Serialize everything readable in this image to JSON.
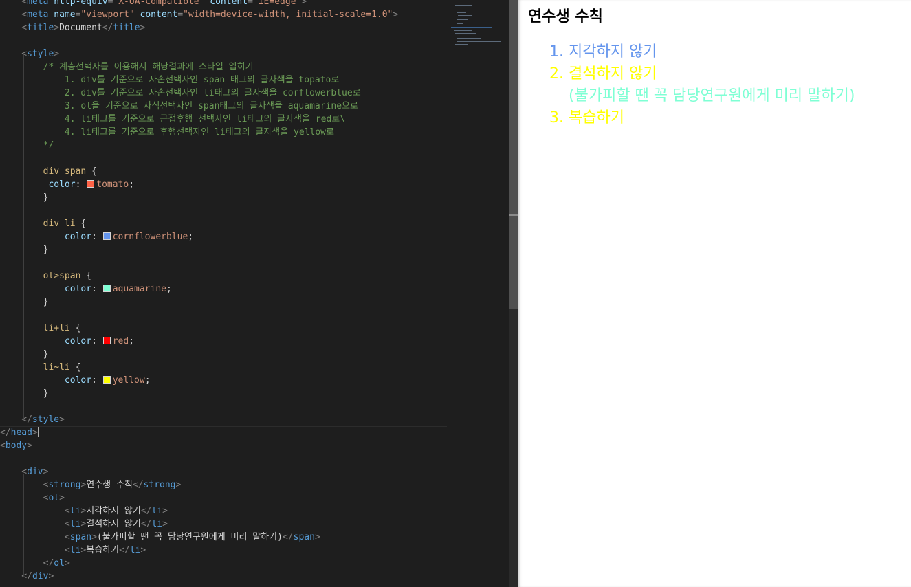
{
  "editor": {
    "lines": [
      [
        {
          "c": "t",
          "t": "    <"
        },
        {
          "c": "tn",
          "t": "meta "
        },
        {
          "c": "an",
          "t": "http-equiv"
        },
        {
          "c": "t",
          "t": "="
        },
        {
          "c": "av",
          "t": "\"X-UA-Compatible\" "
        },
        {
          "c": "an",
          "t": "content"
        },
        {
          "c": "t",
          "t": "="
        },
        {
          "c": "av",
          "t": "\"IE=edge\""
        },
        {
          "c": "t",
          "t": ">"
        }
      ],
      [
        {
          "c": "t",
          "t": "    <"
        },
        {
          "c": "tn",
          "t": "meta "
        },
        {
          "c": "an",
          "t": "name"
        },
        {
          "c": "t",
          "t": "="
        },
        {
          "c": "av",
          "t": "\"viewport\" "
        },
        {
          "c": "an",
          "t": "content"
        },
        {
          "c": "t",
          "t": "="
        },
        {
          "c": "av",
          "t": "\"width=device-width, initial-scale=1.0\""
        },
        {
          "c": "t",
          "t": ">"
        }
      ],
      [
        {
          "c": "t",
          "t": "    <"
        },
        {
          "c": "tn",
          "t": "title"
        },
        {
          "c": "t",
          "t": ">"
        },
        {
          "c": "",
          "t": "Document"
        },
        {
          "c": "t",
          "t": "</"
        },
        {
          "c": "tn",
          "t": "title"
        },
        {
          "c": "t",
          "t": ">"
        }
      ],
      [],
      [
        {
          "c": "t",
          "t": "    <"
        },
        {
          "c": "tn",
          "t": "style"
        },
        {
          "c": "t",
          "t": ">"
        }
      ],
      [
        {
          "c": "cm",
          "t": "        /* 계층선택자를 이용해서 해당결과에 스타일 입히기"
        }
      ],
      [
        {
          "c": "cm",
          "t": "            1. div를 기준으로 자손선택자인 span 태그의 글자색을 topato로"
        }
      ],
      [
        {
          "c": "cm",
          "t": "            2. div를 기준으로 자손선택자인 li태그의 글자색을 corflowerblue로"
        }
      ],
      [
        {
          "c": "cm",
          "t": "            3. ol을 기준으로 자식선택자인 span태그의 글자색을 aquamarine으로"
        }
      ],
      [
        {
          "c": "cm",
          "t": "            4. li태그를 기준으로 근접후행 선택자인 li태그의 글자색을 red로\\"
        }
      ],
      [
        {
          "c": "cm",
          "t": "            4. li태그를 기준으로 후행선택자인 li태그의 글자색을 yellow로"
        }
      ],
      [
        {
          "c": "cm",
          "t": "        */"
        }
      ],
      [],
      [
        {
          "c": "sel",
          "t": "        div span "
        },
        {
          "c": "",
          "t": "{"
        }
      ],
      [
        {
          "c": "",
          "t": "         "
        },
        {
          "c": "pr",
          "t": "color"
        },
        {
          "c": "",
          "t": ": "
        },
        {
          "c": "sw",
          "t": "",
          "col": "tomato"
        },
        {
          "c": "vl",
          "t": "tomato"
        },
        {
          "c": "",
          "t": ";"
        }
      ],
      [
        {
          "c": "",
          "t": "        }"
        }
      ],
      [],
      [
        {
          "c": "sel",
          "t": "        div li "
        },
        {
          "c": "",
          "t": "{"
        }
      ],
      [
        {
          "c": "",
          "t": "            "
        },
        {
          "c": "pr",
          "t": "color"
        },
        {
          "c": "",
          "t": ": "
        },
        {
          "c": "sw",
          "t": "",
          "col": "cornflowerblue"
        },
        {
          "c": "vl",
          "t": "cornflowerblue"
        },
        {
          "c": "",
          "t": ";"
        }
      ],
      [
        {
          "c": "",
          "t": "        }"
        }
      ],
      [],
      [
        {
          "c": "sel",
          "t": "        ol>span "
        },
        {
          "c": "",
          "t": "{"
        }
      ],
      [
        {
          "c": "",
          "t": "            "
        },
        {
          "c": "pr",
          "t": "color"
        },
        {
          "c": "",
          "t": ": "
        },
        {
          "c": "sw",
          "t": "",
          "col": "aquamarine"
        },
        {
          "c": "vl",
          "t": "aquamarine"
        },
        {
          "c": "",
          "t": ";"
        }
      ],
      [
        {
          "c": "",
          "t": "        }"
        }
      ],
      [],
      [
        {
          "c": "sel",
          "t": "        li+li "
        },
        {
          "c": "",
          "t": "{"
        }
      ],
      [
        {
          "c": "",
          "t": "            "
        },
        {
          "c": "pr",
          "t": "color"
        },
        {
          "c": "",
          "t": ": "
        },
        {
          "c": "sw",
          "t": "",
          "col": "red"
        },
        {
          "c": "vl",
          "t": "red"
        },
        {
          "c": "",
          "t": ";"
        }
      ],
      [
        {
          "c": "",
          "t": "        }"
        }
      ],
      [
        {
          "c": "sel",
          "t": "        li~li "
        },
        {
          "c": "",
          "t": "{"
        }
      ],
      [
        {
          "c": "",
          "t": "            "
        },
        {
          "c": "pr",
          "t": "color"
        },
        {
          "c": "",
          "t": ": "
        },
        {
          "c": "sw",
          "t": "",
          "col": "yellow"
        },
        {
          "c": "vl",
          "t": "yellow"
        },
        {
          "c": "",
          "t": ";"
        }
      ],
      [
        {
          "c": "",
          "t": "        }"
        }
      ],
      [],
      [
        {
          "c": "t",
          "t": "    </"
        },
        {
          "c": "tn",
          "t": "style"
        },
        {
          "c": "t",
          "t": ">"
        }
      ],
      [
        {
          "c": "t",
          "t": "</"
        },
        {
          "c": "tn",
          "t": "head"
        },
        {
          "c": "t",
          "t": ">"
        },
        {
          "c": "caret",
          "t": ""
        }
      ],
      [
        {
          "c": "t",
          "t": "<"
        },
        {
          "c": "tn",
          "t": "body"
        },
        {
          "c": "t",
          "t": ">"
        }
      ],
      [],
      [
        {
          "c": "t",
          "t": "    <"
        },
        {
          "c": "tn",
          "t": "div"
        },
        {
          "c": "t",
          "t": ">"
        }
      ],
      [
        {
          "c": "t",
          "t": "        <"
        },
        {
          "c": "tn",
          "t": "strong"
        },
        {
          "c": "t",
          "t": ">"
        },
        {
          "c": "",
          "t": "연수생 수칙"
        },
        {
          "c": "t",
          "t": "</"
        },
        {
          "c": "tn",
          "t": "strong"
        },
        {
          "c": "t",
          "t": ">"
        }
      ],
      [
        {
          "c": "t",
          "t": "        <"
        },
        {
          "c": "tn",
          "t": "ol"
        },
        {
          "c": "t",
          "t": ">"
        }
      ],
      [
        {
          "c": "t",
          "t": "            <"
        },
        {
          "c": "tn",
          "t": "li"
        },
        {
          "c": "t",
          "t": ">"
        },
        {
          "c": "",
          "t": "지각하지 않기"
        },
        {
          "c": "t",
          "t": "</"
        },
        {
          "c": "tn",
          "t": "li"
        },
        {
          "c": "t",
          "t": ">"
        }
      ],
      [
        {
          "c": "t",
          "t": "            <"
        },
        {
          "c": "tn",
          "t": "li"
        },
        {
          "c": "t",
          "t": ">"
        },
        {
          "c": "",
          "t": "결석하지 않기"
        },
        {
          "c": "t",
          "t": "</"
        },
        {
          "c": "tn",
          "t": "li"
        },
        {
          "c": "t",
          "t": ">"
        }
      ],
      [
        {
          "c": "t",
          "t": "            <"
        },
        {
          "c": "tn",
          "t": "span"
        },
        {
          "c": "t",
          "t": ">"
        },
        {
          "c": "",
          "t": "(불가피할 땐 꼭 담당연구원에게 미리 말하기)"
        },
        {
          "c": "t",
          "t": "</"
        },
        {
          "c": "tn",
          "t": "span"
        },
        {
          "c": "t",
          "t": ">"
        }
      ],
      [
        {
          "c": "t",
          "t": "            <"
        },
        {
          "c": "tn",
          "t": "li"
        },
        {
          "c": "t",
          "t": ">"
        },
        {
          "c": "",
          "t": "복습하기"
        },
        {
          "c": "t",
          "t": "</"
        },
        {
          "c": "tn",
          "t": "li"
        },
        {
          "c": "t",
          "t": ">"
        }
      ],
      [
        {
          "c": "t",
          "t": "        </"
        },
        {
          "c": "tn",
          "t": "ol"
        },
        {
          "c": "t",
          "t": ">"
        }
      ],
      [
        {
          "c": "t",
          "t": "    </"
        },
        {
          "c": "tn",
          "t": "div"
        },
        {
          "c": "t",
          "t": ">"
        }
      ]
    ],
    "current_line": 33,
    "colors": {
      "background": "#1e1e1e",
      "tag": "#569cd6",
      "attribute": "#9cdcfe",
      "string": "#ce9178",
      "comment": "#6a9955",
      "selector": "#d7ba7d"
    }
  },
  "preview": {
    "title": "연수생 수칙",
    "items": [
      {
        "type": "li",
        "number": "1.",
        "text": "지각하지 않기",
        "color": "#6495ed"
      },
      {
        "type": "li",
        "number": "2.",
        "text": "결석하지 않기",
        "color": "#ffff00"
      },
      {
        "type": "span",
        "text": "(불가피할 땐 꼭 담당연구원에게 미리 말하기)",
        "color": "#7fffd4"
      },
      {
        "type": "li",
        "number": "3.",
        "text": "복습하기",
        "color": "#ffff00"
      }
    ]
  }
}
